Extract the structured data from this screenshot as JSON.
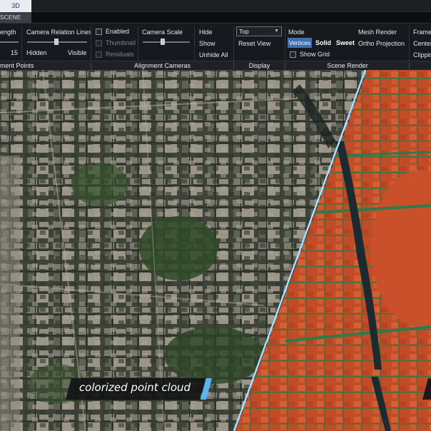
{
  "tabs": {
    "top": "3D",
    "sub": "SCENE"
  },
  "ribbon": {
    "alignment_points": {
      "length_label": "ength",
      "length_value": "15",
      "section_label": "ment Points"
    },
    "camera_relation_lines": {
      "label": "Camera Relation Lines",
      "left": "Hidden",
      "right": "Visible"
    },
    "alignment_cameras": {
      "enabled": "Enabled",
      "thumbnail": "Thumbnail",
      "residuals": "Residuals",
      "camera_scale": "Camera Scale",
      "hide": "Hide",
      "show": "Show",
      "unhide_all": "Unhide All",
      "section_label": "Alignment Cameras"
    },
    "display": {
      "selected": "Top",
      "reset_view": "Reset View",
      "section_label": "Display"
    },
    "scene_render": {
      "mode_label": "Mode",
      "vertices": "Vertices",
      "solid": "Solid",
      "sweet": "Sweet",
      "show_grid": "Show Grid",
      "mesh_render": "Mesh Render",
      "ortho_projection": "Ortho Projection",
      "section_label": "Scene Render"
    },
    "overflow": {
      "frame": "Frame",
      "center": "Center",
      "clipping": "Clippin"
    }
  },
  "viewport": {
    "caption": "colorized point cloud"
  },
  "colors": {
    "accent_blue": "#3f6fb0",
    "divider_line": "#8fd0ff",
    "caption_marker": "#5ab6f2",
    "pointcloud_orange": "#c9502a",
    "pointcloud_green": "#2f7a4a"
  }
}
